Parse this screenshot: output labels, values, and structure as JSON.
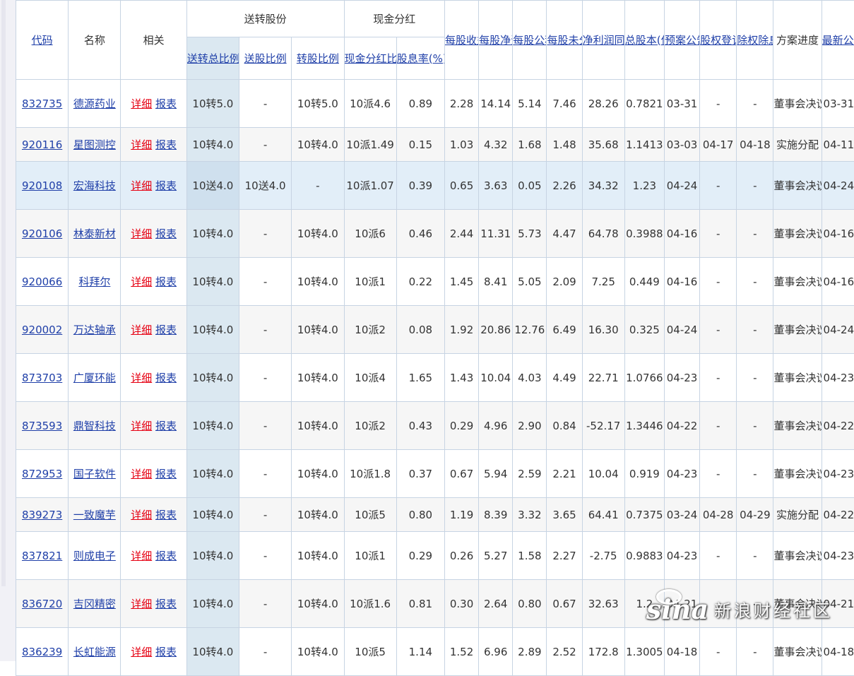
{
  "header": {
    "code": "代码",
    "name": "名称",
    "related": "相关",
    "bonus_group": "送转股份",
    "cash_group": "现金分红",
    "total_ratio": "送转总比例",
    "bonus_ratio": "送股比例",
    "transfer_ratio": "转股比例",
    "cash_ratio": "现金分红比例",
    "yield": "股息率(%)",
    "eps": "每股收益(元)",
    "bvps": "每股净资产(元)",
    "reserve": "每股公积金(元)",
    "undistributed": "每股未分配利润(元)",
    "profit_growth": "净利润同比增长(%)",
    "total_shares": "总股本(亿)",
    "plan_date": "预案公告日",
    "record_date": "股权登记日",
    "ex_date": "除权除息日",
    "progress": "方案进度",
    "latest_date": "最新公告日期"
  },
  "links": {
    "detail": "详细",
    "report": "报表"
  },
  "rows": [
    {
      "code": "832735",
      "name": "德源药业",
      "total": "10转5.0",
      "bonus": "-",
      "transfer": "10转5.0",
      "cash": "10派4.6",
      "yield": "0.89",
      "eps": "2.28",
      "bvps": "14.14",
      "reserve": "5.14",
      "undist": "7.46",
      "growth": "28.26",
      "shares": "0.7821",
      "plan": "03-31",
      "record": "-",
      "ex": "-",
      "progress": "董事会决议通过",
      "latest": "03-31"
    },
    {
      "code": "920116",
      "name": "星图测控",
      "total": "10转4.0",
      "bonus": "-",
      "transfer": "10转4.0",
      "cash": "10派1.49",
      "yield": "0.15",
      "eps": "1.03",
      "bvps": "4.32",
      "reserve": "1.68",
      "undist": "1.48",
      "growth": "35.68",
      "shares": "1.1413",
      "plan": "03-03",
      "record": "04-17",
      "ex": "04-18",
      "progress": "实施分配",
      "latest": "04-11"
    },
    {
      "code": "920108",
      "name": "宏海科技",
      "total": "10送4.0",
      "bonus": "10送4.0",
      "transfer": "-",
      "cash": "10派1.07",
      "yield": "0.39",
      "eps": "0.65",
      "bvps": "3.63",
      "reserve": "0.05",
      "undist": "2.26",
      "growth": "34.32",
      "shares": "1.23",
      "plan": "04-24",
      "record": "-",
      "ex": "-",
      "progress": "董事会决议通过",
      "latest": "04-24"
    },
    {
      "code": "920106",
      "name": "林泰新材",
      "total": "10转4.0",
      "bonus": "-",
      "transfer": "10转4.0",
      "cash": "10派6",
      "yield": "0.46",
      "eps": "2.44",
      "bvps": "11.31",
      "reserve": "5.73",
      "undist": "4.47",
      "growth": "64.78",
      "shares": "0.3988",
      "plan": "04-16",
      "record": "-",
      "ex": "-",
      "progress": "董事会决议通过",
      "latest": "04-16"
    },
    {
      "code": "920066",
      "name": "科拜尔",
      "total": "10转4.0",
      "bonus": "-",
      "transfer": "10转4.0",
      "cash": "10派1",
      "yield": "0.22",
      "eps": "1.45",
      "bvps": "8.41",
      "reserve": "5.05",
      "undist": "2.09",
      "growth": "7.25",
      "shares": "0.449",
      "plan": "04-16",
      "record": "-",
      "ex": "-",
      "progress": "董事会决议通过",
      "latest": "04-16"
    },
    {
      "code": "920002",
      "name": "万达轴承",
      "total": "10转4.0",
      "bonus": "-",
      "transfer": "10转4.0",
      "cash": "10派2",
      "yield": "0.08",
      "eps": "1.92",
      "bvps": "20.86",
      "reserve": "12.76",
      "undist": "6.49",
      "growth": "16.30",
      "shares": "0.325",
      "plan": "04-24",
      "record": "-",
      "ex": "-",
      "progress": "董事会决议通过",
      "latest": "04-24"
    },
    {
      "code": "873703",
      "name": "广厦环能",
      "total": "10转4.0",
      "bonus": "-",
      "transfer": "10转4.0",
      "cash": "10派4",
      "yield": "1.65",
      "eps": "1.43",
      "bvps": "10.04",
      "reserve": "4.03",
      "undist": "4.49",
      "growth": "22.71",
      "shares": "1.0766",
      "plan": "04-23",
      "record": "-",
      "ex": "-",
      "progress": "董事会决议通过",
      "latest": "04-23"
    },
    {
      "code": "873593",
      "name": "鼎智科技",
      "total": "10转4.0",
      "bonus": "-",
      "transfer": "10转4.0",
      "cash": "10派2",
      "yield": "0.43",
      "eps": "0.29",
      "bvps": "4.96",
      "reserve": "2.90",
      "undist": "0.84",
      "growth": "-52.17",
      "shares": "1.3446",
      "plan": "04-22",
      "record": "-",
      "ex": "-",
      "progress": "董事会决议通过",
      "latest": "04-22"
    },
    {
      "code": "872953",
      "name": "国子软件",
      "total": "10转4.0",
      "bonus": "-",
      "transfer": "10转4.0",
      "cash": "10派1.8",
      "yield": "0.37",
      "eps": "0.67",
      "bvps": "5.94",
      "reserve": "2.59",
      "undist": "2.21",
      "growth": "10.04",
      "shares": "0.919",
      "plan": "04-23",
      "record": "-",
      "ex": "-",
      "progress": "董事会决议通过",
      "latest": "04-23"
    },
    {
      "code": "839273",
      "name": "一致魔芋",
      "total": "10转4.0",
      "bonus": "-",
      "transfer": "10转4.0",
      "cash": "10派5",
      "yield": "0.80",
      "eps": "1.19",
      "bvps": "8.39",
      "reserve": "3.32",
      "undist": "3.65",
      "growth": "64.41",
      "shares": "0.7375",
      "plan": "03-24",
      "record": "04-28",
      "ex": "04-29",
      "progress": "实施分配",
      "latest": "04-22"
    },
    {
      "code": "837821",
      "name": "则成电子",
      "total": "10转4.0",
      "bonus": "-",
      "transfer": "10转4.0",
      "cash": "10派1",
      "yield": "0.29",
      "eps": "0.26",
      "bvps": "5.27",
      "reserve": "1.58",
      "undist": "2.27",
      "growth": "-2.75",
      "shares": "0.9883",
      "plan": "04-23",
      "record": "-",
      "ex": "-",
      "progress": "董事会决议通过",
      "latest": "04-23"
    },
    {
      "code": "836720",
      "name": "吉冈精密",
      "total": "10转4.0",
      "bonus": "-",
      "transfer": "10转4.0",
      "cash": "10派1.6",
      "yield": "0.81",
      "eps": "0.30",
      "bvps": "2.64",
      "reserve": "0.80",
      "undist": "0.67",
      "growth": "32.63",
      "shares": "1.2",
      "plan": "04-21",
      "record": "-",
      "ex": "-",
      "progress": "董事会决议通过",
      "latest": "04-21"
    },
    {
      "code": "836239",
      "name": "长虹能源",
      "total": "10转4.0",
      "bonus": "-",
      "transfer": "10转4.0",
      "cash": "10派5",
      "yield": "1.14",
      "eps": "1.52",
      "bvps": "6.96",
      "reserve": "2.89",
      "undist": "2.52",
      "growth": "172.8",
      "shares": "1.3005",
      "plan": "04-18",
      "record": "-",
      "ex": "-",
      "progress": "董事会决议通过",
      "latest": "04-18"
    }
  ],
  "watermark": {
    "logo": "sina",
    "text": "新浪财经社区"
  },
  "colors": {
    "link": "#1f3fa8",
    "red_link": "#e60012",
    "sorted_col": "#dbe8f1",
    "border": "#c7d4e3"
  }
}
